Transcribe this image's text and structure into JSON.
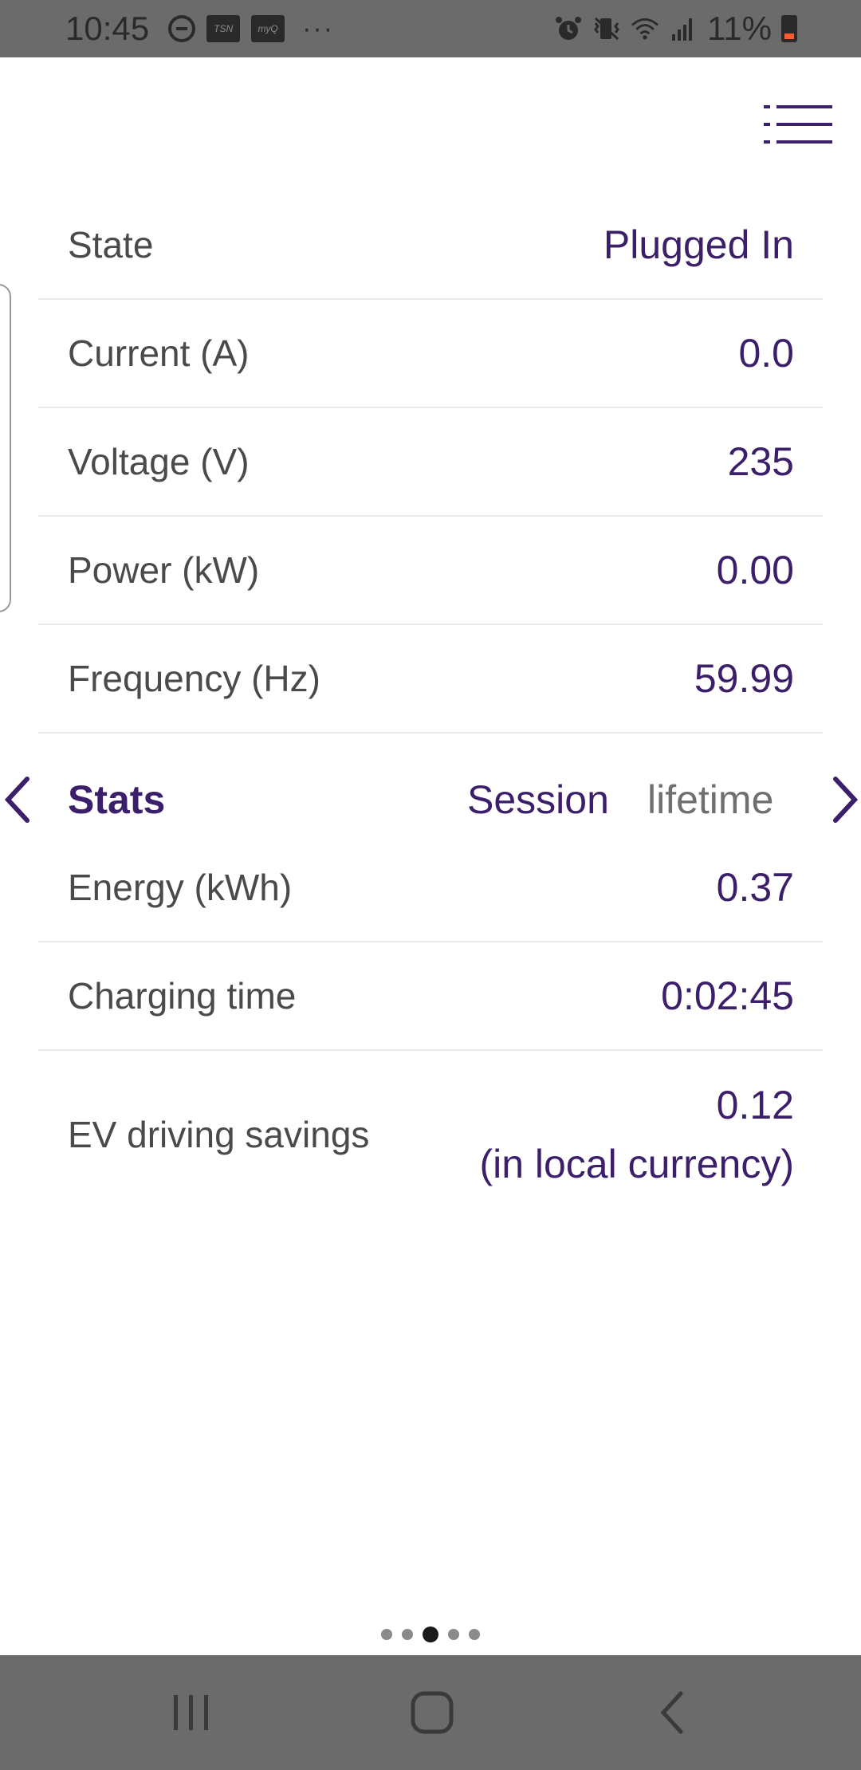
{
  "status_bar": {
    "time": "10:45",
    "app_icon_1": "TSN",
    "app_icon_2": "myQ",
    "more": "···",
    "battery_percent": "11%",
    "icons": [
      "dnd-icon",
      "alarm-icon",
      "vibrate-icon",
      "wifi-icon",
      "signal-icon",
      "battery-icon"
    ]
  },
  "colors": {
    "accent": "#3c1f6b",
    "label": "#4a4a4a",
    "divider": "#e9e9e9",
    "system_bar": "#6b6b6b",
    "battery_low": "#ff5b2e"
  },
  "live": [
    {
      "label": "State",
      "value": "Plugged In"
    },
    {
      "label": "Current (A)",
      "value": "0.0"
    },
    {
      "label": "Voltage (V)",
      "value": "235"
    },
    {
      "label": "Power (kW)",
      "value": "0.00"
    },
    {
      "label": "Frequency (Hz)",
      "value": "59.99"
    }
  ],
  "stats": {
    "title": "Stats",
    "tab_session": "Session",
    "tab_lifetime": "lifetime",
    "selected_tab": "Session",
    "rows": [
      {
        "label": "Energy (kWh)",
        "value": "0.37"
      },
      {
        "label": "Charging time",
        "value": "0:02:45"
      }
    ],
    "savings": {
      "label": "EV driving savings",
      "value": "0.12",
      "note": "(in local currency)"
    }
  },
  "pager": {
    "count": 5,
    "active_index": 2
  }
}
